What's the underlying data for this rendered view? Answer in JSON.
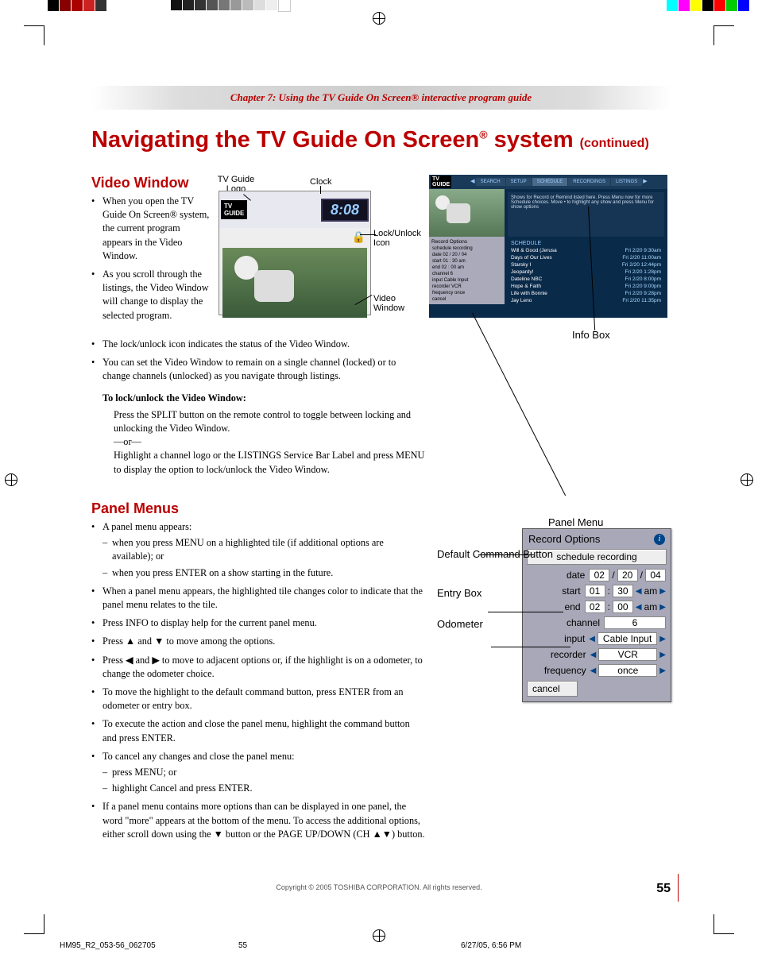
{
  "chapter_header": "Chapter 7: Using the TV Guide On Screen® interactive program guide",
  "heading_main": "Navigating the TV Guide On Screen",
  "heading_reg": "®",
  "heading_sys": " system ",
  "heading_cont": "(continued)",
  "section_video": "Video Window",
  "video_bullets": [
    "When you open the TV Guide On Screen® system, the current program appears in the Video Window.",
    "As you scroll through the listings, the Video Window will change to display the selected program."
  ],
  "video_bullets2": [
    "The lock/unlock icon indicates the status of the Video Window.",
    "You can set the Video Window to remain on a single channel (locked) or to change channels (unlocked) as you navigate through listings."
  ],
  "lock_heading": "To lock/unlock the Video Window:",
  "lock_p1": "Press the SPLIT button on the remote control to toggle between locking and unlocking the Video Window.",
  "lock_or": "—or—",
  "lock_p2": "Highlight a channel logo or the LISTINGS Service Bar Label and press MENU to display the option to lock/unlock the Video Window.",
  "section_panel": "Panel Menus",
  "panel_b1": "A panel menu appears:",
  "panel_d1": "when you press MENU on a highlighted tile (if additional options are available); or",
  "panel_d2": "when you press ENTER on a show starting in the future.",
  "panel_b2": "When a panel menu appears, the highlighted tile changes color to indicate that the panel menu relates to the tile.",
  "panel_b3": "Press INFO to display help for the current panel menu.",
  "panel_b4": "Press ▲ and ▼ to move among the options.",
  "panel_b5": "Press ◀ and ▶ to move to adjacent options or, if the highlight is on a odometer, to change the odometer choice.",
  "panel_b6": "To move the highlight to the default command button, press ENTER from an odometer or entry box.",
  "panel_b7": "To execute the action and close the panel menu, highlight the command button and press ENTER.",
  "panel_b8": "To cancel any changes and close the panel menu:",
  "panel_d3": "press MENU; or",
  "panel_d4": "highlight Cancel and press ENTER.",
  "panel_b9": "If a panel menu contains more options than can be displayed in one panel, the word \"more\" appears at the bottom of the menu. To access the additional options, either scroll down using the ▼ button or the PAGE UP/DOWN (CH ▲▼) button.",
  "vw_labels": {
    "logo": "TV Guide Logo",
    "clock": "Clock",
    "lock": "Lock/Unlock Icon",
    "video": "Video Window"
  },
  "vw_clock": "8:08",
  "infobox_label": "Info Box",
  "panelmenu_label": "Panel Menu",
  "callout_labels": {
    "default": "Default Command Button",
    "entry": "Entry Box",
    "odometer": "Odometer"
  },
  "record_panel": {
    "title": "Record Options",
    "schedule": "schedule recording",
    "date_lbl": "date",
    "date": [
      "02",
      "20",
      "04"
    ],
    "start_lbl": "start",
    "start": [
      "01",
      "30",
      "am"
    ],
    "end_lbl": "end",
    "end": [
      "02",
      "00",
      "am"
    ],
    "channel_lbl": "channel",
    "channel": "6",
    "input_lbl": "input",
    "input": "Cable Input",
    "recorder_lbl": "recorder",
    "recorder": "VCR",
    "frequency_lbl": "frequency",
    "frequency": "once",
    "cancel": "cancel"
  },
  "tv_screenshot": {
    "tabs": [
      "SEARCH",
      "SETUP",
      "SCHEDULE",
      "RECORDINGS",
      "LISTINGS"
    ],
    "info_text": "Shows for Record or Remind listed here. Press Menu now for more Schedule choices. Move • to highlight any show and press Menu for show options",
    "panel_title": "Record Options",
    "panel_rows": [
      "schedule recording",
      "date 02 / 20 / 04",
      "start 01 : 30 am",
      "end 02 : 00 am",
      "channel 6",
      "input Cable Input",
      "recorder VCR",
      "frequency once",
      "cancel"
    ],
    "schedule_title": "SCHEDULE",
    "shows": [
      {
        "t": "Will & Good (Jerusa",
        "d": "Fri 2/20  9:30am"
      },
      {
        "t": "Days of Our Lives",
        "d": "Fri 2/20 11:00am"
      },
      {
        "t": "Starsky I",
        "d": "Fri 2/20 12:44pm"
      },
      {
        "t": "Jeopardy!",
        "d": "Fri 2/20  1:28pm"
      },
      {
        "t": "Dateline NBC",
        "d": "Fri 2/20  8:00pm"
      },
      {
        "t": "Hope & Faith",
        "d": "Fri 2/20  9:00pm"
      },
      {
        "t": "Life with Bonnie",
        "d": "Fri 2/20  9:28pm"
      },
      {
        "t": "Jay Leno",
        "d": "Fri 2/20 11:35pm"
      }
    ]
  },
  "page_num": "55",
  "copyright": "Copyright © 2005 TOSHIBA CORPORATION. All rights reserved.",
  "slug_left": "HM95_R2_053-56_062705",
  "slug_mid": "55",
  "slug_right": "6/27/05, 6:56 PM"
}
